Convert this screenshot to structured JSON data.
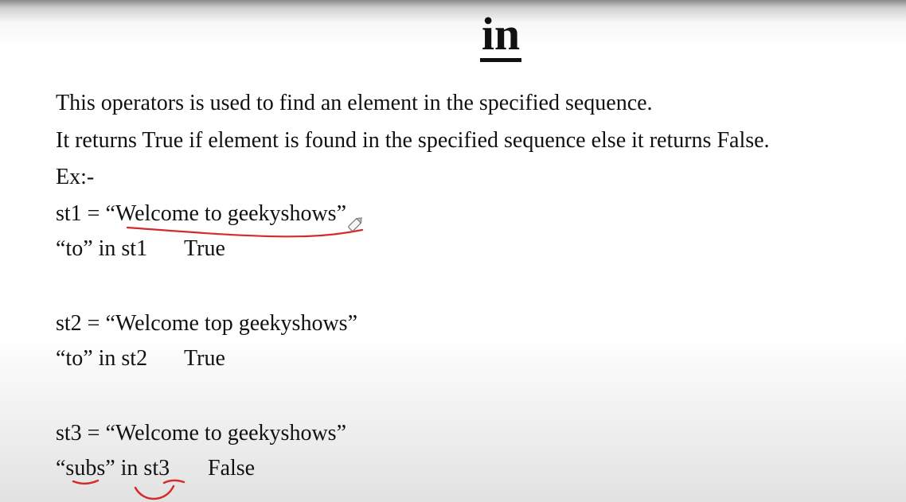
{
  "slide": {
    "title": "in",
    "description_1": "This operators is used to find an element in the specified sequence.",
    "description_2": "It returns True if element is found in the specified sequence else it returns False.",
    "example_label": "Ex:-"
  },
  "examples": [
    {
      "assignment": "st1 = “Welcome to geekyshows”",
      "expression": "“to” in st1",
      "result": "True"
    },
    {
      "assignment": "st2 = “Welcome top geekyshows”",
      "expression": "“to” in st2",
      "result": "True"
    },
    {
      "assignment": "st3 = “Welcome to geekyshows”",
      "expression": "“subs” in st3",
      "result": "False"
    }
  ],
  "annotation_color": "#d42a2a"
}
